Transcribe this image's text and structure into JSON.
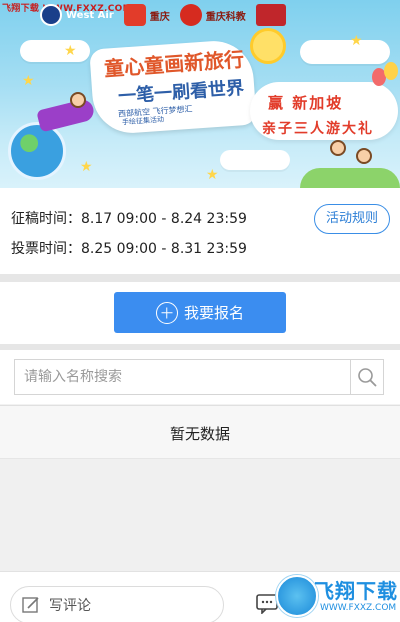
{
  "banner": {
    "watermark": "飞翔下载 WWW.FXXZ.COM",
    "logos": [
      "West Air",
      "重庆",
      "重庆科教",
      "北游 联名"
    ],
    "title_line1": "童心童画新旅行",
    "title_line2": "一笔一刷看世界",
    "subtitle": "西部航空 飞行梦想汇",
    "subtitle2": "手绘征集活动",
    "prize_line1": "赢 新加坡",
    "prize_line2": "亲子三人游大礼"
  },
  "info": {
    "submission_time": "征稿时间：8.17 09:00 - 8.24 23:59",
    "voting_time": "投票时间：8.25 09:00 - 8.31 23:59",
    "rules_label": "活动规则"
  },
  "signup": {
    "label": "我要报名"
  },
  "search": {
    "placeholder": "请输入名称搜索"
  },
  "empty_state": {
    "text": "暂无数据"
  },
  "bottom_bar": {
    "comment_placeholder": "写评论"
  },
  "site_watermark": {
    "big": "飞翔下载",
    "small": "WWW.FXXZ.COM"
  },
  "colors": {
    "accent": "#3b8df0",
    "rules_border": "#3a8ee6",
    "banner_sky": "#a5def3"
  }
}
